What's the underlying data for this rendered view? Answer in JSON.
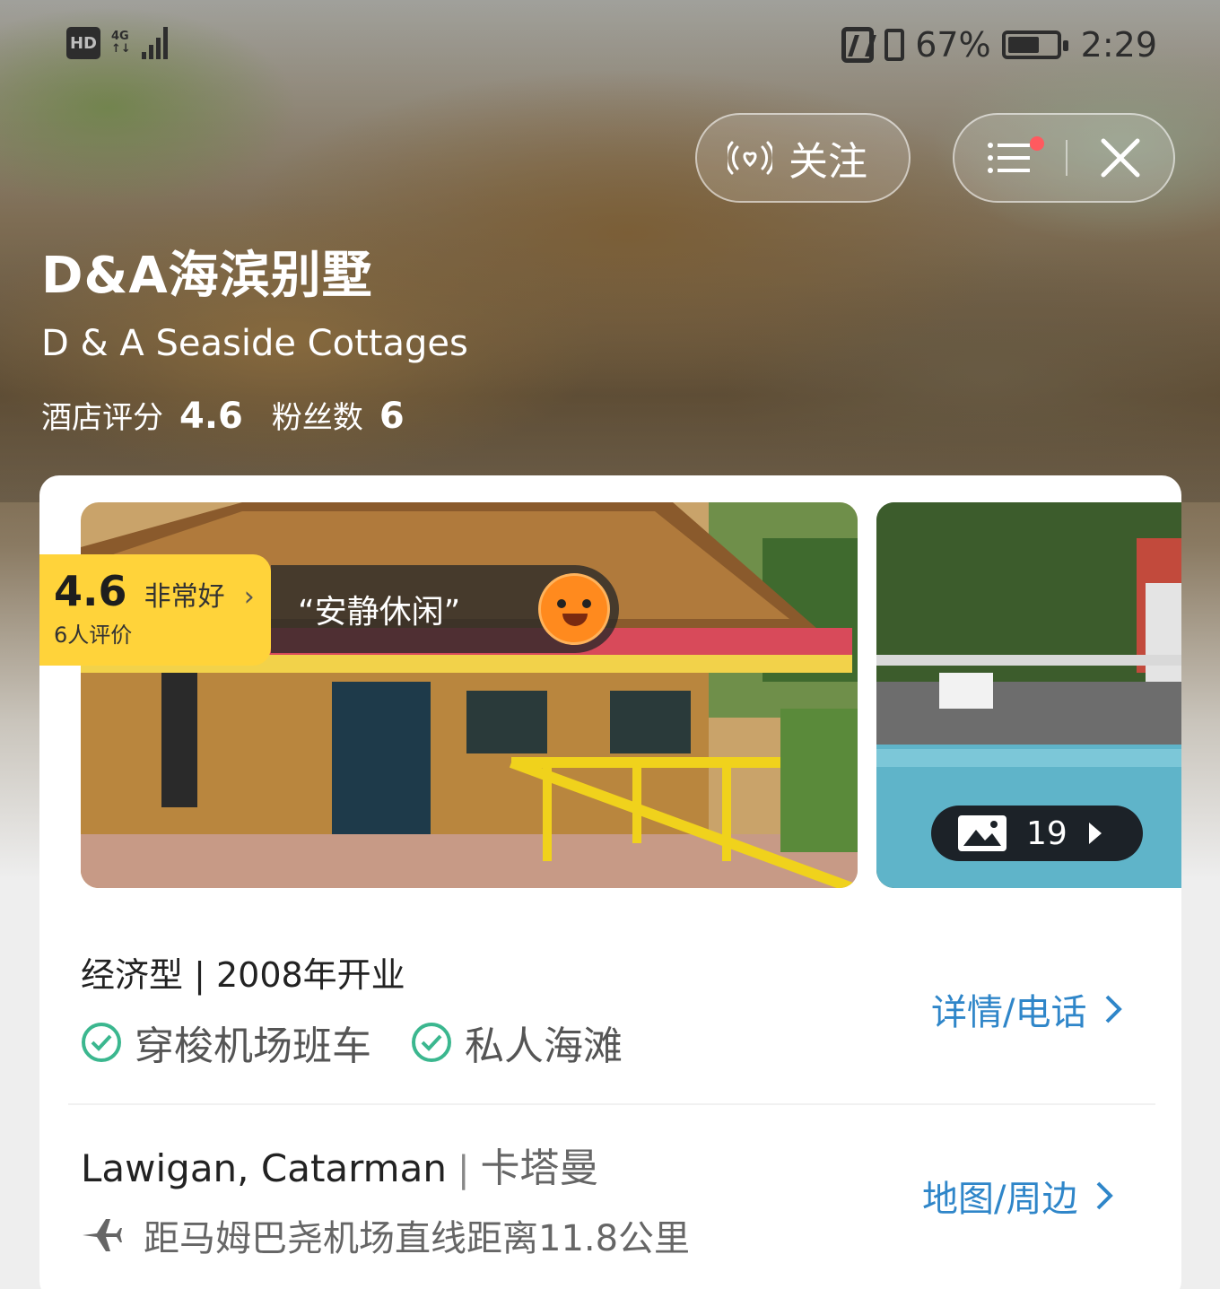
{
  "status_bar": {
    "hd": "HD",
    "network": "4G",
    "battery": "67%",
    "battery_level": 0.67,
    "time": "2:29"
  },
  "actions": {
    "follow_label": "关注",
    "icons": [
      "follow-broadcast-icon",
      "list-menu-icon",
      "close-icon"
    ]
  },
  "hotel": {
    "name_cn": "D&A海滨别墅",
    "name_en": "D & A Seaside Cottages",
    "rating_label": "酒店评分",
    "rating_value": "4.6",
    "fans_label": "粉丝数",
    "fans_value": "6"
  },
  "review_badge": {
    "score": "4.6",
    "desc": "非常好",
    "count": "6人评价",
    "quote": "“安静休闲”"
  },
  "gallery": {
    "photo_count": "19"
  },
  "info": {
    "type_line": "经济型 | 2008年开业",
    "amenities": [
      "穿梭机场班车",
      "私人海滩"
    ],
    "details_link": "详情/电话",
    "address_en": "Lawigan, Catarman",
    "address_sep": "|",
    "address_cn": "卡塔曼",
    "airport_distance": "距马姆巴尧机场直线距离11.8公里",
    "map_link": "地图/周边"
  },
  "colors": {
    "accent_link": "#2f86c9",
    "badge_yellow": "#ffd33a",
    "check_green": "#3bb78f"
  }
}
